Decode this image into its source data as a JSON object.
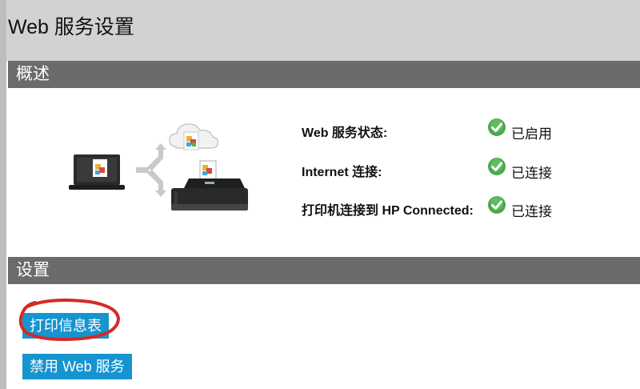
{
  "page": {
    "title": "Web 服务设置"
  },
  "overview": {
    "section_label": "概述",
    "statuses": [
      {
        "label": "Web 服务状态:",
        "value": "已启用",
        "icon": "check-circle-icon"
      },
      {
        "label": "Internet 连接:",
        "value": "已连接",
        "icon": "check-circle-icon"
      },
      {
        "label": "打印机连接到 HP Connected:",
        "value": "已连接",
        "icon": "check-circle-icon"
      }
    ]
  },
  "settings": {
    "section_label": "设置",
    "print_info_button": "打印信息表",
    "disable_web_services_button": "禁用 Web 服务"
  },
  "colors": {
    "header_bg": "#d2d2d2",
    "section_bar": "#6b6b6b",
    "button_blue": "#1694cf",
    "annotation_red": "#d42a2a",
    "check_green": "#4ca84c"
  }
}
